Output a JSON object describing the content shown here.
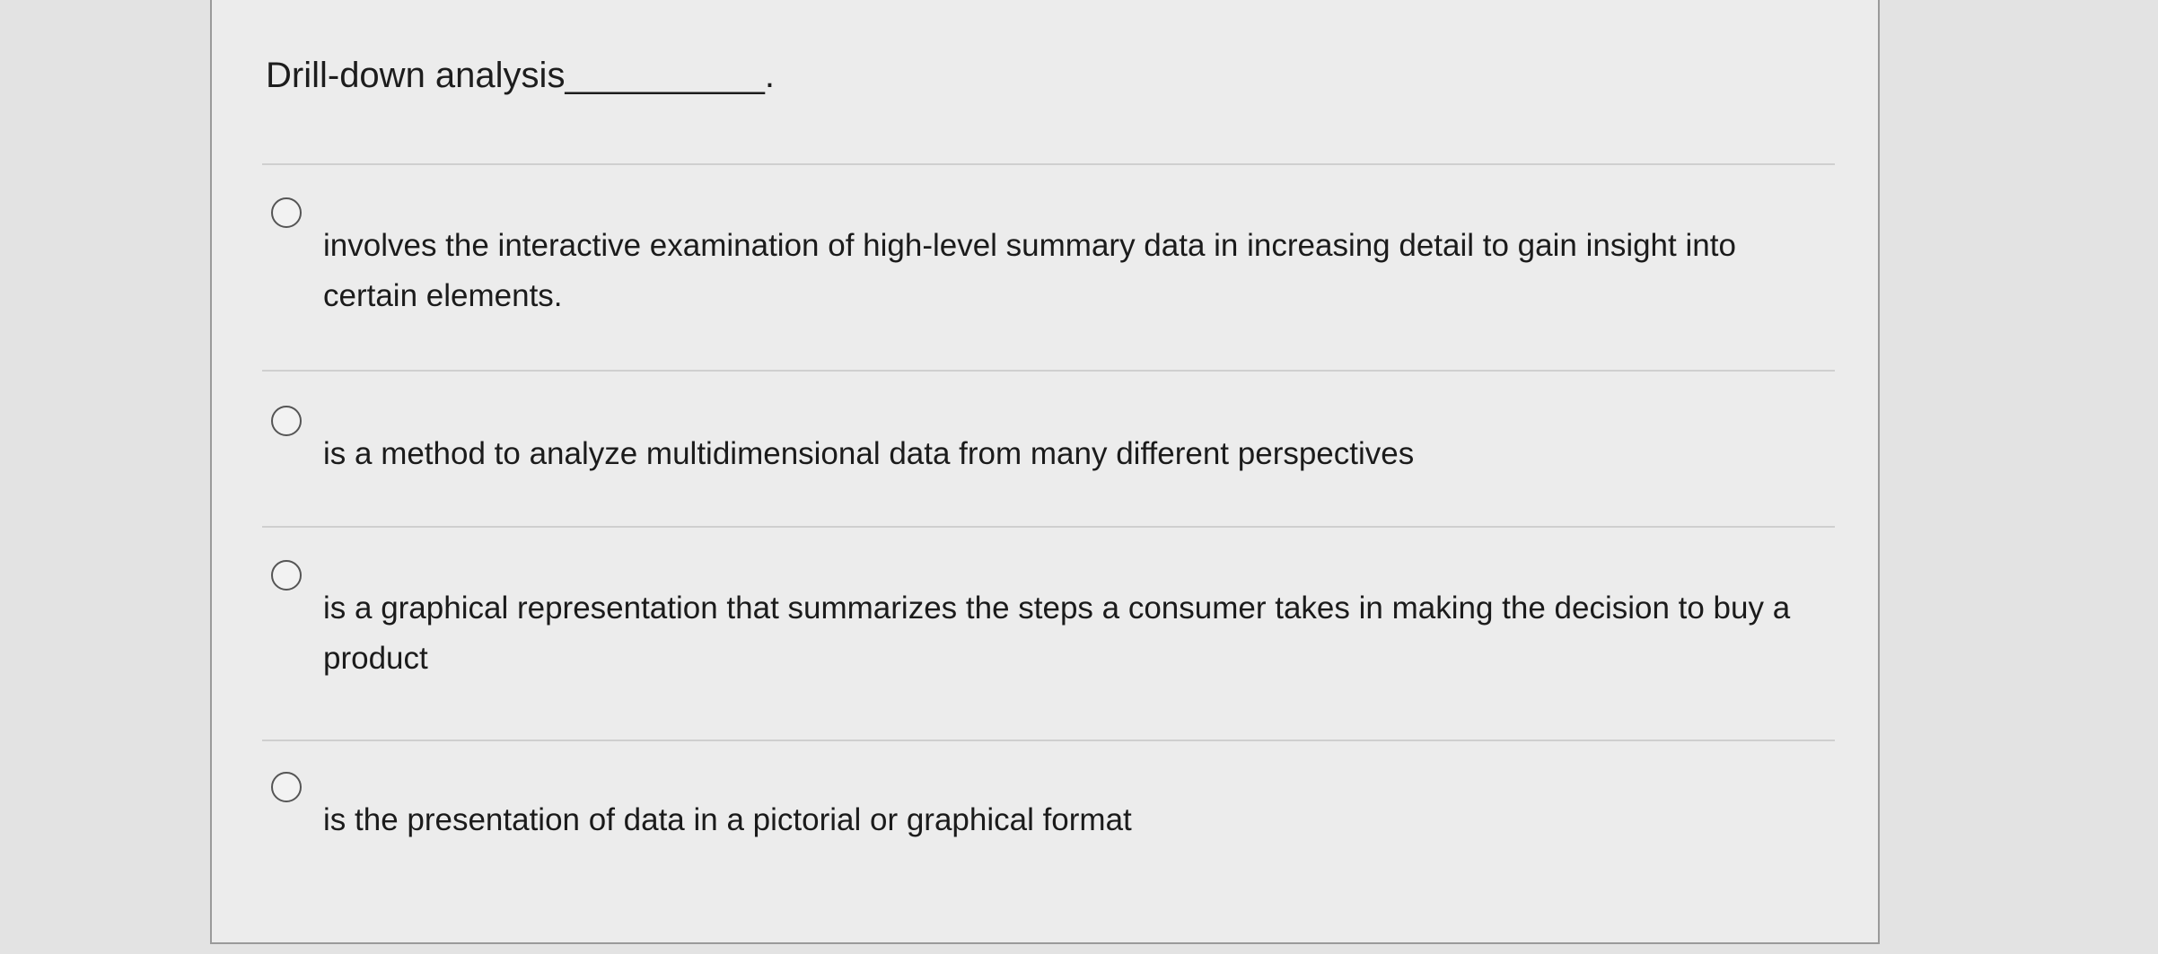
{
  "question": {
    "stem": "Drill-down analysis__________."
  },
  "options": [
    {
      "text": "involves the interactive examination of high-level summary data in increasing detail to gain insight into certain elements."
    },
    {
      "text": "is a method to analyze multidimensional data from many different perspectives"
    },
    {
      "text": "is a graphical representation that summarizes the steps a consumer takes in making the decision to buy a product"
    },
    {
      "text": "is the presentation of data in a pictorial or graphical format"
    }
  ]
}
